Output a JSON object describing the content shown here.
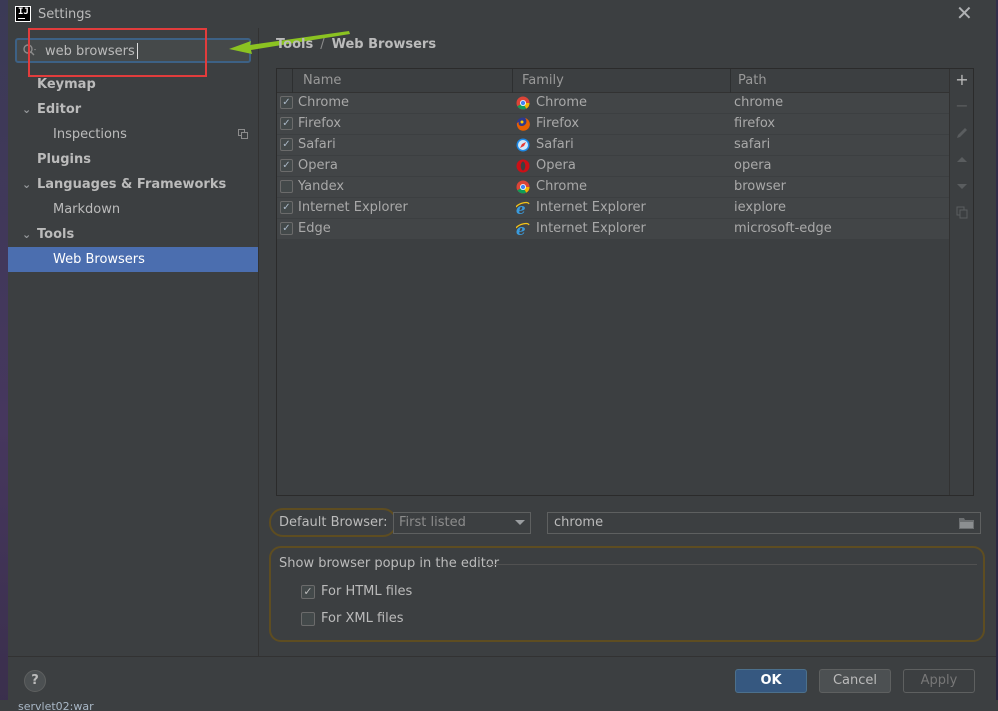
{
  "window": {
    "title": "Settings",
    "app_icon_text": "IJ"
  },
  "search": {
    "value": "web browsers"
  },
  "tree": [
    {
      "label": "Keymap",
      "bold": true,
      "indent": 0,
      "chevron": ""
    },
    {
      "label": "Editor",
      "bold": true,
      "indent": 0,
      "chevron": "open"
    },
    {
      "label": "Inspections",
      "bold": false,
      "indent": 1,
      "chevron": "",
      "copy_icon": true
    },
    {
      "label": "Plugins",
      "bold": true,
      "indent": 0,
      "chevron": ""
    },
    {
      "label": "Languages & Frameworks",
      "bold": true,
      "indent": 0,
      "chevron": "open"
    },
    {
      "label": "Markdown",
      "bold": false,
      "indent": 1,
      "chevron": ""
    },
    {
      "label": "Tools",
      "bold": true,
      "indent": 0,
      "chevron": "open"
    },
    {
      "label": "Web Browsers",
      "bold": false,
      "indent": 1,
      "chevron": "",
      "selected": true
    }
  ],
  "breadcrumb": {
    "parent": "Tools",
    "separator": "/",
    "current": "Web Browsers"
  },
  "table": {
    "headers": {
      "name": "Name",
      "family": "Family",
      "path": "Path"
    },
    "rows": [
      {
        "checked": true,
        "name": "Chrome",
        "family": "Chrome",
        "family_icon": "chrome-icon",
        "path": "chrome"
      },
      {
        "checked": true,
        "name": "Firefox",
        "family": "Firefox",
        "family_icon": "firefox-icon",
        "path": "firefox"
      },
      {
        "checked": true,
        "name": "Safari",
        "family": "Safari",
        "family_icon": "safari-icon",
        "path": "safari"
      },
      {
        "checked": true,
        "name": "Opera",
        "family": "Opera",
        "family_icon": "opera-icon",
        "path": "opera"
      },
      {
        "checked": false,
        "name": "Yandex",
        "family": "Chrome",
        "family_icon": "chrome-icon",
        "path": "browser"
      },
      {
        "checked": true,
        "name": "Internet Explorer",
        "family": "Internet Explorer",
        "family_icon": "ie-icon",
        "path": "iexplore"
      },
      {
        "checked": true,
        "name": "Edge",
        "family": "Internet Explorer",
        "family_icon": "ie-icon",
        "path": "microsoft-edge"
      }
    ]
  },
  "toolbar": {
    "add": "+",
    "remove": "−"
  },
  "default_browser": {
    "label": "Default Browser:",
    "selected": "First listed",
    "path": "chrome"
  },
  "popup": {
    "title": "Show browser popup in the editor",
    "options": [
      {
        "label": "For HTML files",
        "checked": true
      },
      {
        "label": "For XML files",
        "checked": false
      }
    ]
  },
  "footer": {
    "help": "?",
    "ok": "OK",
    "cancel": "Cancel",
    "apply": "Apply"
  },
  "taskbar": {
    "text": "servlet02:war"
  },
  "colors": {
    "accent": "#4b6eaf",
    "highlight_red": "#e23c3c",
    "arrow_green": "#8bc321",
    "outline_gold": "#5e4d21"
  }
}
